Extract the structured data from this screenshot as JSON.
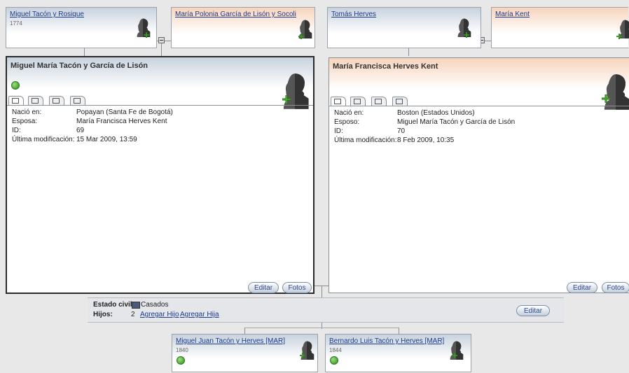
{
  "parents": {
    "father_father": {
      "name": "Miguel Tacón y Rosique",
      "year": "1774"
    },
    "father_mother": {
      "name": "María Polonia García de Lisón y Socoli"
    },
    "mother_father": {
      "name": "Tomás Herves"
    },
    "mother_mother": {
      "name": "María Kent"
    }
  },
  "husband": {
    "name": "Miguel María Tacón y García de Lisón",
    "fields": [
      {
        "k": "Nació en:",
        "v": "Popayan (Santa Fe de Bogotá)"
      },
      {
        "k": "Esposa:",
        "v": "María Francisca Herves Kent"
      },
      {
        "k": "ID:",
        "v": "69"
      },
      {
        "k": "Última modificación:",
        "v": "15 Mar 2009, 13:59"
      }
    ],
    "buttons": {
      "edit": "Editar",
      "photos": "Fotos"
    }
  },
  "wife": {
    "name": "María Francisca Herves Kent",
    "fields": [
      {
        "k": "Nació en:",
        "v": "Boston (Estados Unidos)"
      },
      {
        "k": "Esposo:",
        "v": "Miguel María Tacón y García de Lisón"
      },
      {
        "k": "ID:",
        "v": "70"
      },
      {
        "k": "Última modificación:",
        "v": "8 Feb 2009, 10:35"
      }
    ],
    "buttons": {
      "edit": "Editar",
      "photos": "Fotos"
    }
  },
  "family": {
    "civil_label": "Estado civil:",
    "civil_value": "Casados",
    "children_label": "Hijos:",
    "children_count": "2",
    "add_son": "Agregar Hijo",
    "add_daughter": "Agregar Hija",
    "edit": "Editar"
  },
  "children": [
    {
      "name": "Miguel Juan Tacón y Herves [MAR]",
      "year": "1840"
    },
    {
      "name": "Bernardo Luis Tacón y Herves [MAR]",
      "year": "1844"
    }
  ],
  "colors": {
    "male": "#c8d2dd",
    "female": "#f7d4bc"
  }
}
